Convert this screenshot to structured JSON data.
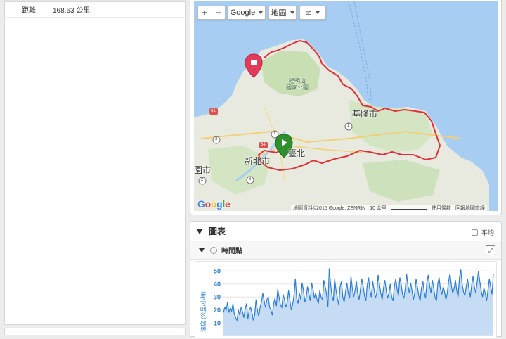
{
  "summary": {
    "distance_label": "距離:",
    "distance_value": "168.63 公里"
  },
  "map": {
    "zoom_in": "+",
    "zoom_out": "−",
    "provider_menu": "Google",
    "type_menu": "地圖",
    "layers_icon": "layers-icon",
    "labels": {
      "park": "陽明山\n國家公園",
      "keelung": "基隆市",
      "taipei": "臺北",
      "newtaipei": "新北市",
      "taoyuan": "園市"
    },
    "route_shields": [
      "61",
      "2",
      "1",
      "64",
      "1",
      "2",
      "3"
    ],
    "google_logo": "Google",
    "attribution": "地圖資料©2015 Google, ZENRIN",
    "scale": "10 公里",
    "terms": "使用條款",
    "report": "回報地圖錯誤",
    "colors": {
      "water": "#a7cdf3",
      "land": "#e9eadf",
      "park": "#c7dfb2",
      "route": "#e2303a",
      "start_marker": "#2f8f2f",
      "end_marker": "#e53b5b"
    }
  },
  "chart": {
    "title": "圖表",
    "average_label": "平均",
    "subsection_title": "時間點",
    "expand_icon": "expand-icon"
  },
  "chart_data": {
    "type": "area",
    "ylabel": "速度 (公里/小時)",
    "yticks": [
      10,
      20,
      30,
      40,
      50
    ],
    "ylim": [
      0,
      55
    ],
    "color": "#2a7ed8",
    "values": [
      18,
      22,
      20,
      26,
      18,
      21,
      19,
      25,
      17,
      14,
      12,
      20,
      16,
      22,
      19,
      14,
      21,
      25,
      13,
      20,
      22,
      18,
      12,
      16,
      28,
      20,
      15,
      22,
      26,
      33,
      27,
      22,
      28,
      30,
      22,
      20,
      16,
      25,
      29,
      23,
      36,
      30,
      24,
      22,
      32,
      28,
      22,
      26,
      35,
      27,
      20,
      24,
      31,
      44,
      29,
      25,
      33,
      28,
      41,
      35,
      26,
      30,
      38,
      32,
      27,
      41,
      36,
      29,
      33,
      28,
      25,
      35,
      30,
      28,
      43,
      38,
      32,
      22,
      52,
      40,
      31,
      27,
      44,
      35,
      29,
      24,
      38,
      42,
      30,
      26,
      34,
      41,
      33,
      29,
      46,
      37,
      30,
      35,
      42,
      33,
      28,
      36,
      44,
      38,
      31,
      27,
      39,
      45,
      35,
      30,
      42,
      36,
      29,
      33,
      47,
      40,
      33,
      28,
      37,
      43,
      35,
      29,
      33,
      40,
      30,
      27,
      38,
      44,
      36,
      31,
      45,
      40,
      32,
      29,
      36,
      48,
      39,
      33,
      41,
      35,
      28,
      33,
      44,
      38,
      31,
      27,
      37,
      42,
      34,
      29,
      41,
      47,
      39,
      33,
      43,
      37,
      30,
      27,
      40,
      45,
      36,
      32,
      38,
      34,
      28,
      33,
      42,
      48,
      39,
      33,
      36,
      43,
      35,
      30,
      45,
      51,
      40,
      34,
      31,
      38,
      44,
      36,
      30,
      39,
      46,
      38,
      33,
      41,
      50,
      42,
      35,
      30,
      37,
      33,
      27,
      35,
      44,
      38,
      32,
      48
    ]
  }
}
